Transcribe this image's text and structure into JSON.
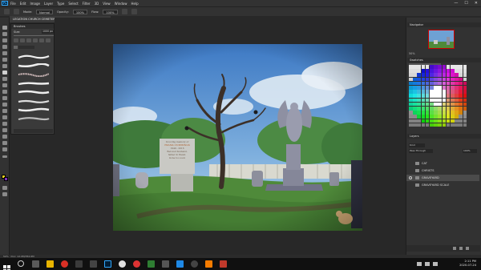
{
  "app": {
    "logo": "Ps",
    "menu": [
      "File",
      "Edit",
      "Image",
      "Layer",
      "Type",
      "Select",
      "Filter",
      "3D",
      "View",
      "Window",
      "Help"
    ],
    "window_controls": [
      "—",
      "☐",
      "✕"
    ]
  },
  "options_bar": {
    "mode_label": "Mode:",
    "mode_value": "Normal",
    "opacity_label": "Opacity:",
    "opacity_value": "100%",
    "flow_label": "Flow:",
    "flow_value": "100%"
  },
  "document_tab": {
    "title": "LEGATION CHURCH CEMETERY.psd @ 50% (GRAVEYARD, RGB/8) *"
  },
  "brush_panel": {
    "title": "Brushes",
    "size_label": "Size:",
    "size_value": "1000 px"
  },
  "navigator": {
    "title": "Navigator",
    "zoom": "50%"
  },
  "swatches": {
    "title": "Swatches"
  },
  "layers_panel": {
    "title": "Layers",
    "blend_mode": "Pass Through",
    "opacity": "100%",
    "layers": [
      {
        "name": "CAT",
        "visible": false,
        "selected": false
      },
      {
        "name": "CHRISTS",
        "visible": false,
        "selected": false
      },
      {
        "name": "GRAVEYARD",
        "visible": true,
        "selected": true
      },
      {
        "name": "GRAVEYARD SCALE",
        "visible": false,
        "selected": false
      }
    ]
  },
  "canvas": {
    "tombstone_lines": [
      "In loving memory of",
      "FRANK CUMMINGS",
      "1949 - 2016",
      "Beloved husband,",
      "father & friend.",
      "Gone too soon"
    ]
  },
  "status_bar": {
    "zoom": "50%",
    "doc": "Doc: 12.0M/352.6M"
  },
  "taskbar": {
    "time": "2:11 PM",
    "date": "2020-07-24"
  },
  "colors": {
    "accent": "#31a8ff",
    "panel_bg": "#323232",
    "canvas_bg": "#282828",
    "selected_layer": "#4b4b4b"
  }
}
